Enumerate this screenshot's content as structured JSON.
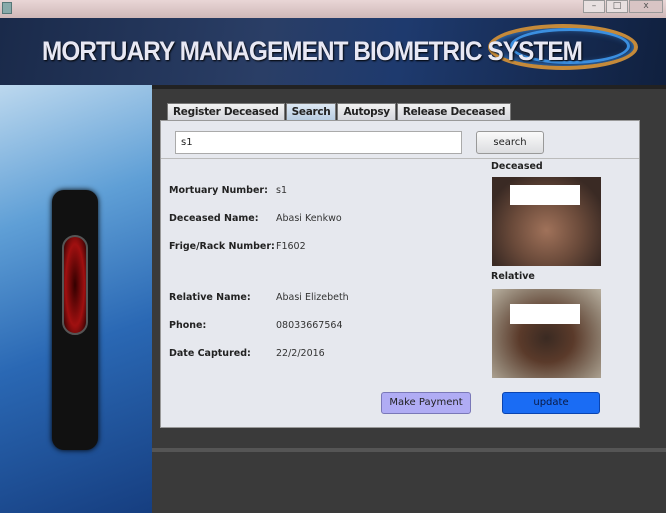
{
  "window": {
    "minimize": "–",
    "maximize": "□",
    "close": "x"
  },
  "banner": {
    "title": "MORTUARY MANAGEMENT BIOMETRIC SYSTEM"
  },
  "tabs": [
    {
      "label": "Register Deceased",
      "active": false
    },
    {
      "label": "Search",
      "active": true
    },
    {
      "label": "Autopsy",
      "active": false
    },
    {
      "label": "Release Deceased",
      "active": false
    }
  ],
  "search": {
    "value": "s1",
    "button": "search"
  },
  "fields": [
    {
      "label": "Mortuary Number:",
      "value": "s1"
    },
    {
      "label": "Deceased Name:",
      "value": "Abasi Kenkwo"
    },
    {
      "label": "Frige/Rack Number:",
      "value": "F1602"
    },
    {
      "label": "Relative Name:",
      "value": "Abasi Elizebeth"
    },
    {
      "label": "Phone:",
      "value": "08033667564"
    },
    {
      "label": "Date Captured:",
      "value": "22/2/2016"
    }
  ],
  "photos": {
    "deceased_label": "Deceased",
    "relative_label": "Relative"
  },
  "buttons": {
    "make_payment": "Make Payment",
    "update": "update"
  },
  "colors": {
    "make_payment": "#b0acf4",
    "update": "#1a6cf4"
  }
}
